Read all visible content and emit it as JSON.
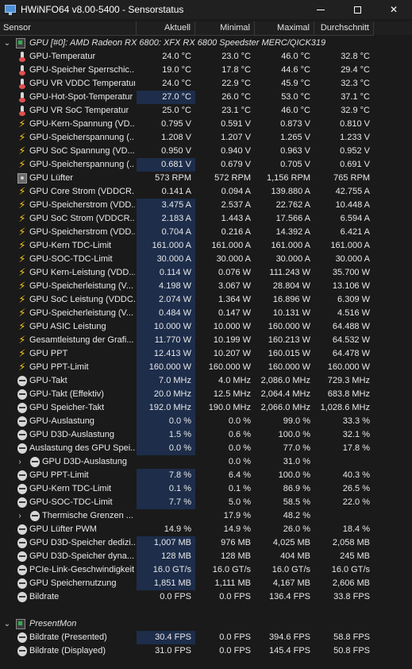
{
  "window": {
    "title": "HWiNFO64 v8.00-5400 - Sensorstatus"
  },
  "columns": [
    "Sensor",
    "Aktuell",
    "Minimal",
    "Maximal",
    "Durchschnitt"
  ],
  "groups": [
    {
      "name": "GPU [#0]: AMD Radeon RX 6800: XFX RX 6800 Speedster MERC/QICK319",
      "icon": "chip-icon",
      "rows": [
        {
          "label": "GPU-Temperatur",
          "icon": "thermometer-icon",
          "v": [
            "24.0 °C",
            "23.0 °C",
            "46.0 °C",
            "32.8 °C"
          ]
        },
        {
          "label": "GPU-Speicher Sperrschic...",
          "icon": "thermometer-icon",
          "v": [
            "19.0 °C",
            "17.8 °C",
            "44.6 °C",
            "29.4 °C"
          ]
        },
        {
          "label": "GPU VR VDDC Temperatur",
          "icon": "thermometer-icon",
          "v": [
            "24.0 °C",
            "22.9 °C",
            "45.9 °C",
            "32.3 °C"
          ]
        },
        {
          "label": "GPU-Hot-Spot-Temperatur",
          "icon": "thermometer-icon",
          "v": [
            "27.0 °C",
            "26.0 °C",
            "53.0 °C",
            "37.1 °C"
          ]
        },
        {
          "label": "GPU VR SoC Temperatur",
          "icon": "thermometer-icon",
          "v": [
            "25.0 °C",
            "23.1 °C",
            "46.0 °C",
            "32.9 °C"
          ]
        },
        {
          "label": "GPU-Kern-Spannung (VD...",
          "icon": "bolt-icon",
          "v": [
            "0.795 V",
            "0.591 V",
            "0.873 V",
            "0.810 V"
          ]
        },
        {
          "label": "GPU-Speicherspannung (...",
          "icon": "bolt-icon",
          "v": [
            "1.208 V",
            "1.207 V",
            "1.265 V",
            "1.233 V"
          ]
        },
        {
          "label": "GPU SoC Spannung (VD...",
          "icon": "bolt-icon",
          "v": [
            "0.950 V",
            "0.940 V",
            "0.963 V",
            "0.952 V"
          ]
        },
        {
          "label": "GPU-Speicherspannung (...",
          "icon": "bolt-icon",
          "v": [
            "0.681 V",
            "0.679 V",
            "0.705 V",
            "0.691 V"
          ]
        },
        {
          "label": "GPU Lüfter",
          "icon": "fan-icon",
          "v": [
            "573 RPM",
            "572 RPM",
            "1,156 RPM",
            "765 RPM"
          ]
        },
        {
          "label": "GPU Core Strom (VDDCR...",
          "icon": "bolt-icon",
          "v": [
            "0.141 A",
            "0.094 A",
            "139.880 A",
            "42.755 A"
          ]
        },
        {
          "label": "GPU-Speicherstrom (VDD...",
          "icon": "bolt-icon",
          "v": [
            "3.475 A",
            "2.537 A",
            "22.762 A",
            "10.448 A"
          ]
        },
        {
          "label": "GPU SoC Strom (VDDCR...",
          "icon": "bolt-icon",
          "v": [
            "2.183 A",
            "1.443 A",
            "17.566 A",
            "6.594 A"
          ]
        },
        {
          "label": "GPU-Speicherstrom (VDD...",
          "icon": "bolt-icon",
          "v": [
            "0.704 A",
            "0.216 A",
            "14.392 A",
            "6.421 A"
          ]
        },
        {
          "label": "GPU-Kern TDC-Limit",
          "icon": "bolt-icon",
          "v": [
            "161.000 A",
            "161.000 A",
            "161.000 A",
            "161.000 A"
          ]
        },
        {
          "label": "GPU-SOC-TDC-Limit",
          "icon": "bolt-icon",
          "v": [
            "30.000 A",
            "30.000 A",
            "30.000 A",
            "30.000 A"
          ]
        },
        {
          "label": "GPU Kern-Leistung (VDD...",
          "icon": "bolt-icon",
          "v": [
            "0.114 W",
            "0.076 W",
            "111.243 W",
            "35.700 W"
          ]
        },
        {
          "label": "GPU-Speicherleistung (V...",
          "icon": "bolt-icon",
          "v": [
            "4.198 W",
            "3.067 W",
            "28.804 W",
            "13.106 W"
          ]
        },
        {
          "label": "GPU SoC Leistung (VDDC...",
          "icon": "bolt-icon",
          "v": [
            "2.074 W",
            "1.364 W",
            "16.896 W",
            "6.309 W"
          ]
        },
        {
          "label": "GPU-Speicherleistung (V...",
          "icon": "bolt-icon",
          "v": [
            "0.484 W",
            "0.147 W",
            "10.131 W",
            "4.516 W"
          ]
        },
        {
          "label": "GPU ASIC Leistung",
          "icon": "bolt-icon",
          "v": [
            "10.000 W",
            "10.000 W",
            "160.000 W",
            "64.488 W"
          ]
        },
        {
          "label": "Gesamtleistung der Grafi...",
          "icon": "bolt-icon",
          "v": [
            "11.770 W",
            "10.199 W",
            "160.213 W",
            "64.532 W"
          ]
        },
        {
          "label": "GPU PPT",
          "icon": "bolt-icon",
          "v": [
            "12.413 W",
            "10.207 W",
            "160.015 W",
            "64.478 W"
          ]
        },
        {
          "label": "GPU PPT-Limit",
          "icon": "bolt-icon",
          "v": [
            "160.000 W",
            "160.000 W",
            "160.000 W",
            "160.000 W"
          ]
        },
        {
          "label": "GPU-Takt",
          "icon": "clock-icon",
          "v": [
            "7.0 MHz",
            "4.0 MHz",
            "2,086.0 MHz",
            "729.3 MHz"
          ]
        },
        {
          "label": "GPU-Takt (Effektiv)",
          "icon": "clock-icon",
          "v": [
            "20.0 MHz",
            "12.5 MHz",
            "2,064.4 MHz",
            "683.8 MHz"
          ]
        },
        {
          "label": "GPU Speicher-Takt",
          "icon": "clock-icon",
          "v": [
            "192.0 MHz",
            "190.0 MHz",
            "2,066.0 MHz",
            "1,028.6 MHz"
          ]
        },
        {
          "label": "GPU-Auslastung",
          "icon": "usage-icon",
          "v": [
            "0.0 %",
            "0.0 %",
            "99.0 %",
            "33.3 %"
          ]
        },
        {
          "label": "GPU D3D-Auslastung",
          "icon": "usage-icon",
          "v": [
            "1.5 %",
            "0.6 %",
            "100.0 %",
            "32.1 %"
          ]
        },
        {
          "label": "Auslastung des GPU Spei...",
          "icon": "usage-icon",
          "v": [
            "0.0 %",
            "0.0 %",
            "77.0 %",
            "17.8 %"
          ]
        },
        {
          "label": "GPU D3D-Auslastung",
          "icon": "usage-icon",
          "sub": true,
          "v": [
            "",
            "0.0 %",
            "31.0 %",
            ""
          ]
        },
        {
          "label": "GPU PPT-Limit",
          "icon": "usage-icon",
          "v": [
            "7.8 %",
            "6.4 %",
            "100.0 %",
            "40.3 %"
          ]
        },
        {
          "label": "GPU-Kern TDC-Limit",
          "icon": "usage-icon",
          "v": [
            "0.1 %",
            "0.1 %",
            "86.9 %",
            "26.5 %"
          ]
        },
        {
          "label": "GPU-SOC-TDC-Limit",
          "icon": "usage-icon",
          "v": [
            "7.7 %",
            "5.0 %",
            "58.5 %",
            "22.0 %"
          ]
        },
        {
          "label": "Thermische Grenzen ...",
          "icon": "usage-icon",
          "sub": true,
          "v": [
            "",
            "17.9 %",
            "48.2 %",
            ""
          ]
        },
        {
          "label": "GPU Lüfter PWM",
          "icon": "usage-icon",
          "v": [
            "14.9 %",
            "14.9 %",
            "26.0 %",
            "18.4 %"
          ]
        },
        {
          "label": "GPU D3D-Speicher dedizi...",
          "icon": "usage-icon",
          "v": [
            "1,007 MB",
            "976 MB",
            "4,025 MB",
            "2,058 MB"
          ]
        },
        {
          "label": "GPU D3D-Speicher dyna...",
          "icon": "usage-icon",
          "v": [
            "128 MB",
            "128 MB",
            "404 MB",
            "245 MB"
          ]
        },
        {
          "label": "PCIe-Link-Geschwindigkeit",
          "icon": "usage-icon",
          "v": [
            "16.0 GT/s",
            "16.0 GT/s",
            "16.0 GT/s",
            "16.0 GT/s"
          ]
        },
        {
          "label": "GPU Speichernutzung",
          "icon": "usage-icon",
          "v": [
            "1,851 MB",
            "1,111 MB",
            "4,167 MB",
            "2,606 MB"
          ]
        },
        {
          "label": "Bildrate",
          "icon": "usage-icon",
          "v": [
            "0.0 FPS",
            "0.0 FPS",
            "136.4 FPS",
            "33.8 FPS"
          ]
        }
      ]
    },
    {
      "name": "PresentMon",
      "icon": "chip-icon",
      "rows": [
        {
          "label": "Bildrate (Presented)",
          "icon": "usage-icon",
          "v": [
            "30.4 FPS",
            "0.0 FPS",
            "394.6 FPS",
            "58.8 FPS"
          ]
        },
        {
          "label": "Bildrate (Displayed)",
          "icon": "usage-icon",
          "v": [
            "31.0 FPS",
            "0.0 FPS",
            "145.4 FPS",
            "50.8 FPS"
          ]
        }
      ]
    }
  ]
}
